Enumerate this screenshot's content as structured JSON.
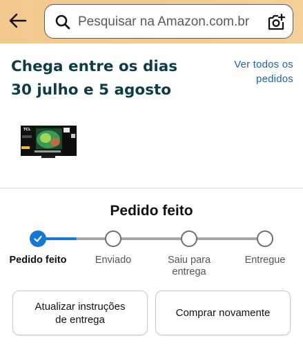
{
  "header": {
    "back_icon": "arrow-left-icon",
    "search": {
      "placeholder": "Pesquisar na Amazon.com.br",
      "search_icon": "magnifier-icon",
      "camera_icon": "camera-icon"
    },
    "colors": {
      "header_bg": "#f2ca93"
    }
  },
  "delivery": {
    "title": "Chega entre os dias\n30 julho e 5 agosto",
    "view_all_orders": "Ver todos os pedidos",
    "title_color": "#0d3b47",
    "link_color": "#2163a8"
  },
  "product": {
    "thumbnail": "tv-product-thumbnail",
    "brand_mark": "TCL"
  },
  "status": {
    "title": "Pedido feito",
    "current_step": 0,
    "steps": [
      {
        "label": "Pedido feito",
        "done": true
      },
      {
        "label": "Enviado",
        "done": false
      },
      {
        "label": "Saiu para\nentrega",
        "done": false
      },
      {
        "label": "Entregue",
        "done": false
      }
    ],
    "accent_color": "#1777d6"
  },
  "actions": {
    "update_instructions": "Atualizar instruções\nde entrega",
    "buy_again": "Comprar novamente"
  }
}
